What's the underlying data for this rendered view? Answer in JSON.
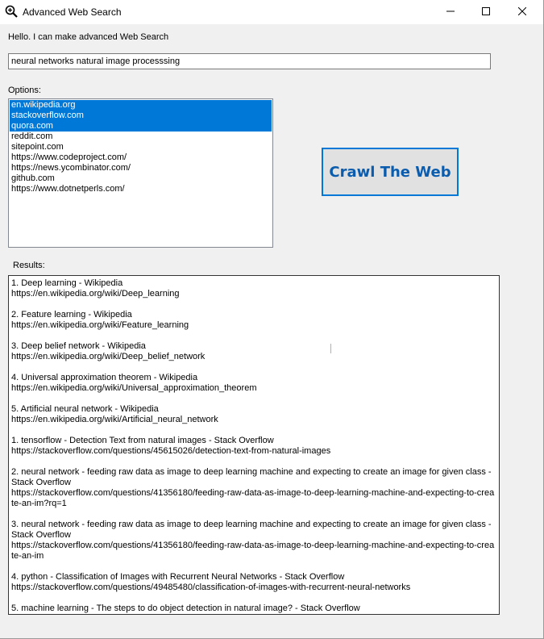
{
  "window": {
    "title": "Advanced Web Search"
  },
  "greeting": "Hello. I can make advanced Web Search",
  "search": {
    "value": "neural networks natural image processsing"
  },
  "options": {
    "label": "Options:",
    "items": [
      {
        "label": "en.wikipedia.org",
        "selected": true
      },
      {
        "label": "stackoverflow.com",
        "selected": true
      },
      {
        "label": "quora.com",
        "selected": true
      },
      {
        "label": "reddit.com",
        "selected": false
      },
      {
        "label": "sitepoint.com",
        "selected": false
      },
      {
        "label": "https://www.codeproject.com/",
        "selected": false
      },
      {
        "label": "https://news.ycombinator.com/",
        "selected": false
      },
      {
        "label": "github.com",
        "selected": false
      },
      {
        "label": "https://www.dotnetperls.com/",
        "selected": false
      }
    ]
  },
  "crawl_button": {
    "label": "Crawl The Web"
  },
  "results": {
    "label": "Results:",
    "blocks": [
      [
        "1. Deep learning - Wikipedia",
        "https://en.wikipedia.org/wiki/Deep_learning"
      ],
      [
        "2. Feature learning - Wikipedia",
        "https://en.wikipedia.org/wiki/Feature_learning"
      ],
      [
        "3. Deep belief network - Wikipedia",
        "https://en.wikipedia.org/wiki/Deep_belief_network"
      ],
      [
        "4. Universal approximation theorem - Wikipedia",
        "https://en.wikipedia.org/wiki/Universal_approximation_theorem"
      ],
      [
        "5. Artificial neural network - Wikipedia",
        "https://en.wikipedia.org/wiki/Artificial_neural_network"
      ],
      [
        "1. tensorflow - Detection Text from natural images - Stack Overflow",
        "https://stackoverflow.com/questions/45615026/detection-text-from-natural-images"
      ],
      [
        "2. neural network - feeding raw data as image to deep learning machine and expecting to create an image for given class - Stack Overflow",
        "https://stackoverflow.com/questions/41356180/feeding-raw-data-as-image-to-deep-learning-machine-and-expecting-to-create-an-im?rq=1"
      ],
      [
        "3. neural network - feeding raw data as image to deep learning machine and expecting to create an image for given class - Stack Overflow",
        "https://stackoverflow.com/questions/41356180/feeding-raw-data-as-image-to-deep-learning-machine-and-expecting-to-create-an-im"
      ],
      [
        "4. python - Classification of Images with Recurrent Neural Networks - Stack Overflow",
        "https://stackoverflow.com/questions/49485480/classification-of-images-with-recurrent-neural-networks"
      ],
      [
        "5. machine learning - The steps to do object detection in natural image? - Stack Overflow"
      ]
    ]
  },
  "colors": {
    "selection": "#0078d7",
    "button_border": "#0078d7",
    "button_text": "#0b5cad"
  }
}
